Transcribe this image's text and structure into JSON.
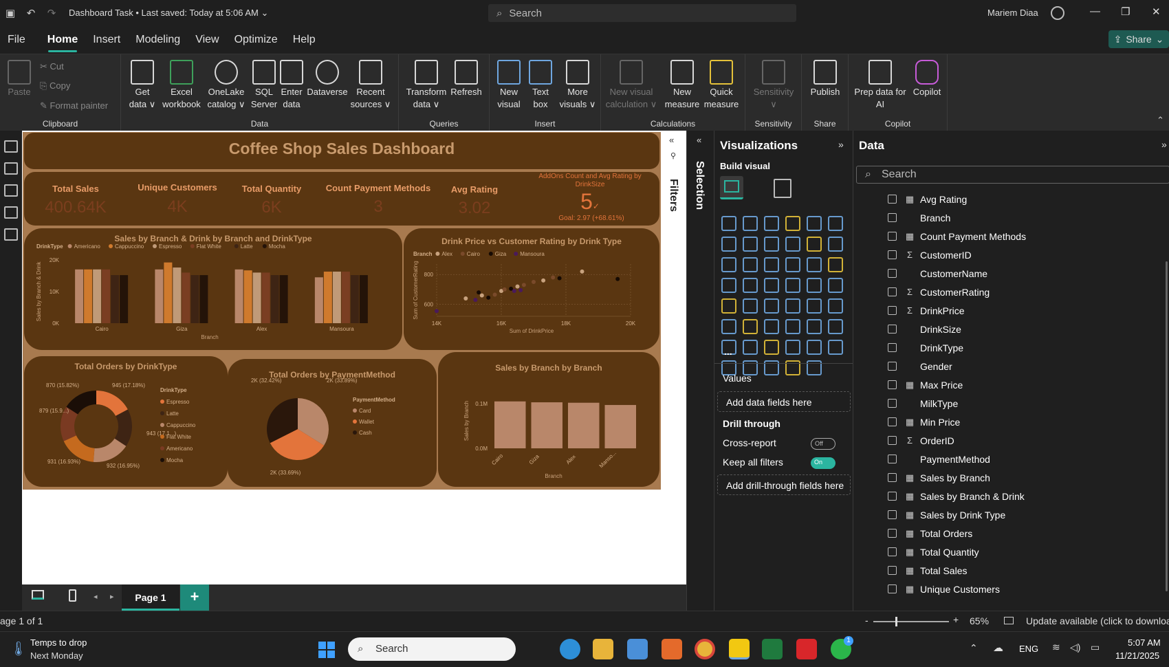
{
  "titlebar": {
    "doc_title": "Dashboard Task",
    "saved": "Last saved: Today at 5:06 AM",
    "search": "Search",
    "user": "Mariem Diaa"
  },
  "menu": {
    "items": [
      "File",
      "Home",
      "Insert",
      "Modeling",
      "View",
      "Optimize",
      "Help"
    ],
    "active": "Home",
    "share": "Share"
  },
  "ribbon": {
    "clipboard": {
      "label": "Clipboard",
      "paste": "Paste",
      "cut": "Cut",
      "copy": "Copy",
      "format_painter": "Format painter"
    },
    "data": {
      "label": "Data",
      "get_data": [
        "Get",
        "data ∨"
      ],
      "excel": [
        "Excel",
        "workbook"
      ],
      "onelake": [
        "OneLake",
        "catalog ∨"
      ],
      "sql": [
        "SQL",
        "Server"
      ],
      "enter": [
        "Enter",
        "data"
      ],
      "dataverse": [
        "Dataverse",
        ""
      ],
      "recent": [
        "Recent",
        "sources ∨"
      ]
    },
    "queries": {
      "label": "Queries",
      "transform": [
        "Transform",
        "data ∨"
      ],
      "refresh": [
        "Refresh",
        ""
      ]
    },
    "insert": {
      "label": "Insert",
      "new_visual": [
        "New",
        "visual"
      ],
      "text_box": [
        "Text",
        "box"
      ],
      "more_visuals": [
        "More",
        "visuals ∨"
      ]
    },
    "calculations": {
      "label": "Calculations",
      "new_visual_calc": [
        "New visual",
        "calculation ∨"
      ],
      "new_measure": [
        "New",
        "measure"
      ],
      "quick_measure": [
        "Quick",
        "measure"
      ]
    },
    "sensitivity": {
      "label": "Sensitivity",
      "sensitivity": [
        "Sensitivity",
        "∨"
      ]
    },
    "share": {
      "label": "Share",
      "publish": [
        "Publish",
        ""
      ]
    },
    "copilot": {
      "label": "Copilot",
      "prep": [
        "Prep data for",
        "AI"
      ],
      "copilot": [
        "Copilot",
        ""
      ]
    }
  },
  "dashboard": {
    "title": "Coffee Shop Sales Dashboard",
    "kpis": [
      {
        "label": "Total Sales",
        "value": "400.64K"
      },
      {
        "label": "Unique Customers",
        "value": "4K"
      },
      {
        "label": "Total Quantity",
        "value": "6K"
      },
      {
        "label": "Count Payment Methods",
        "value": "3"
      },
      {
        "label": "Avg Rating",
        "value": "3.02"
      }
    ],
    "addons": {
      "title": "AddOns Count and Avg Rating by DrinkSize",
      "value": "5",
      "goal": "Goal: 2.97 (+68.61%)"
    }
  },
  "chart_data": [
    {
      "type": "bar",
      "title": "Sales by Branch & Drink by Branch and DrinkType",
      "legend_title": "DrinkType",
      "xlabel": "Branch",
      "ylabel": "Sales by Branch & Drink",
      "categories": [
        "Cairo",
        "Giza",
        "Alex",
        "Mansoura"
      ],
      "yticks": [
        "0K",
        "10K",
        "20K"
      ],
      "ylim": [
        0,
        20000
      ],
      "series": [
        {
          "name": "Americano",
          "color": "#b9876a",
          "values": [
            17000,
            17000,
            17000,
            14500
          ]
        },
        {
          "name": "Cappuccino",
          "color": "#cf7a2d",
          "values": [
            17000,
            19200,
            16700,
            16300
          ]
        },
        {
          "name": "Espresso",
          "color": "#c09a78",
          "values": [
            17000,
            17600,
            16000,
            16300
          ]
        },
        {
          "name": "Flat White",
          "color": "#7a3e22",
          "values": [
            17000,
            16000,
            16000,
            16300
          ]
        },
        {
          "name": "Latte",
          "color": "#3e2414",
          "values": [
            15200,
            15200,
            15200,
            15200
          ]
        },
        {
          "name": "Mocha",
          "color": "#241308",
          "values": [
            15200,
            15200,
            15200,
            15200
          ]
        }
      ]
    },
    {
      "type": "scatter",
      "title": "Drink Price vs Customer Rating by Drink Type",
      "legend_title": "Branch",
      "xlabel": "Sum of DrinkPrice",
      "ylabel": "Sum of CustomerRating",
      "xticks": [
        "14K",
        "16K",
        "18K",
        "20K"
      ],
      "xlim": [
        14000,
        20000
      ],
      "yticks": [
        "600",
        "800"
      ],
      "ylim": [
        520,
        870
      ],
      "series": [
        {
          "name": "Alex",
          "color": "#c8a27e",
          "points": [
            [
              14900,
              640
            ],
            [
              15400,
              660
            ],
            [
              16000,
              690
            ],
            [
              16500,
              720
            ],
            [
              17300,
              760
            ],
            [
              18500,
              820
            ]
          ]
        },
        {
          "name": "Cairo",
          "color": "#7a4a2a",
          "points": [
            [
              15800,
              665
            ],
            [
              16100,
              700
            ],
            [
              16700,
              730
            ],
            [
              17600,
              780
            ],
            [
              17000,
              750
            ]
          ]
        },
        {
          "name": "Giza",
          "color": "#160a03",
          "points": [
            [
              15300,
              680
            ],
            [
              15600,
              645
            ],
            [
              16300,
              705
            ],
            [
              17800,
              775
            ],
            [
              19600,
              770
            ]
          ]
        },
        {
          "name": "Mansoura",
          "color": "#4a1a5a",
          "points": [
            [
              14000,
              555
            ],
            [
              15200,
              630
            ],
            [
              16400,
              690
            ],
            [
              16600,
              695
            ]
          ]
        }
      ]
    },
    {
      "type": "pie",
      "title": "Total Orders by DrinkType",
      "legend_title": "DrinkType",
      "donut": true,
      "slices": [
        {
          "name": "Espresso",
          "value": 945,
          "label": "945 (17.18%)",
          "color": "#e3743b"
        },
        {
          "name": "Latte",
          "value": 943,
          "label": "943 (17.1...)",
          "color": "#3e2414"
        },
        {
          "name": "Cappuccino",
          "value": 932,
          "label": "932 (16.95%)",
          "color": "#b9876a"
        },
        {
          "name": "Flat White",
          "value": 931,
          "label": "931 (16.93%)",
          "color": "#c56a1e"
        },
        {
          "name": "Americano",
          "value": 879,
          "label": "879 (15.9...)",
          "color": "#7a3a22"
        },
        {
          "name": "Mocha",
          "value": 870,
          "label": "870 (15.82%)",
          "color": "#1a0e07"
        }
      ]
    },
    {
      "type": "pie",
      "title": "Total Orders by PaymentMethod",
      "legend_title": "PaymentMethod",
      "slices": [
        {
          "name": "Card",
          "value": 33.89,
          "label": "2K (33.89%)",
          "color": "#b9876a"
        },
        {
          "name": "Wallet",
          "value": 33.69,
          "label": "2K (33.69%)",
          "color": "#e3743b"
        },
        {
          "name": "Cash",
          "value": 32.42,
          "label": "2K (32.42%)",
          "color": "#2a170b"
        }
      ]
    },
    {
      "type": "bar",
      "title": "Sales by Branch by Branch",
      "xlabel": "Branch",
      "ylabel": "Sales by Branch",
      "categories": [
        "Cairo",
        "Giza",
        "Alex",
        "Manso..."
      ],
      "yticks": [
        "0.0M",
        "0.1M"
      ],
      "ylim": [
        0,
        120000
      ],
      "values": [
        105000,
        103000,
        102000,
        97000
      ],
      "color": "#b9876a"
    }
  ],
  "panes": {
    "filters": "Filters",
    "selection": "Selection",
    "visualizations": {
      "title": "Visualizations",
      "build_visual": "Build visual",
      "values": "Values",
      "add_data": "Add data fields here",
      "drill": "Drill through",
      "cross_report": "Cross-report",
      "cross_state": "Off",
      "keep_filters": "Keep all filters",
      "keep_state": "On",
      "add_drill": "Add drill-through fields here",
      "more": "..."
    },
    "data": {
      "title": "Data",
      "search": "Search",
      "fields": [
        {
          "name": "Avg Rating",
          "icon": "calc"
        },
        {
          "name": "Branch",
          "icon": ""
        },
        {
          "name": "Count Payment Methods",
          "icon": "calc"
        },
        {
          "name": "CustomerID",
          "icon": "sigma"
        },
        {
          "name": "CustomerName",
          "icon": ""
        },
        {
          "name": "CustomerRating",
          "icon": "sigma"
        },
        {
          "name": "DrinkPrice",
          "icon": "sigma"
        },
        {
          "name": "DrinkSize",
          "icon": ""
        },
        {
          "name": "DrinkType",
          "icon": ""
        },
        {
          "name": "Gender",
          "icon": ""
        },
        {
          "name": "Max Price",
          "icon": "calc"
        },
        {
          "name": "MilkType",
          "icon": ""
        },
        {
          "name": "Min Price",
          "icon": "calc"
        },
        {
          "name": "OrderID",
          "icon": "sigma"
        },
        {
          "name": "PaymentMethod",
          "icon": ""
        },
        {
          "name": "Sales by Branch",
          "icon": "calc"
        },
        {
          "name": "Sales by Branch & Drink",
          "icon": "calc"
        },
        {
          "name": "Sales by Drink Type",
          "icon": "calc"
        },
        {
          "name": "Total Orders",
          "icon": "calc"
        },
        {
          "name": "Total Quantity",
          "icon": "calc"
        },
        {
          "name": "Total Sales",
          "icon": "calc"
        },
        {
          "name": "Unique Customers",
          "icon": "calc"
        }
      ]
    }
  },
  "pagebar": {
    "page": "Page 1",
    "add": "+"
  },
  "status": {
    "page_of": "age 1 of 1",
    "zoom": "65%",
    "update": "Update available (click to download",
    "minus": "-",
    "plus": "+"
  },
  "taskbar": {
    "weather_title": "Temps to drop",
    "weather_sub": "Next Monday",
    "search": "Search",
    "lang": "ENG",
    "time": "5:07 AM",
    "date": "11/21/2025",
    "badge": "1"
  }
}
